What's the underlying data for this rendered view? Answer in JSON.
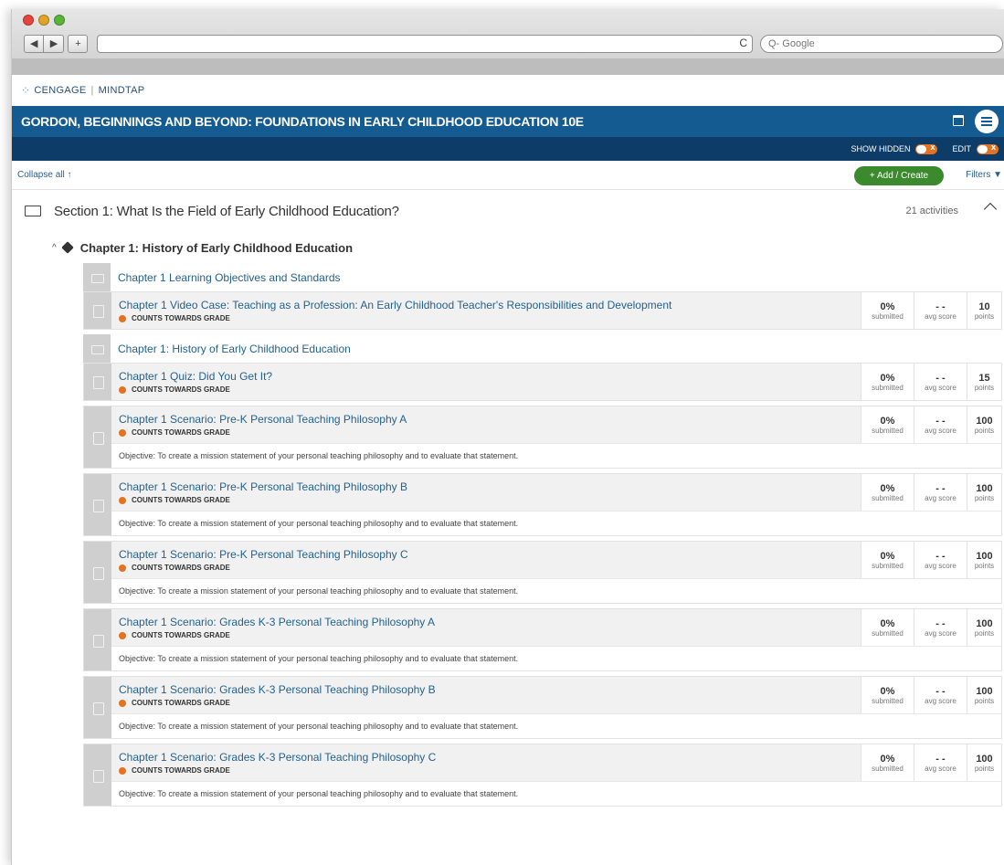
{
  "browser": {
    "back_glyph": "◀",
    "forward_glyph": "▶",
    "new_tab_glyph": "+",
    "reload_glyph": "C",
    "search_placeholder": "Q- Google"
  },
  "brand": {
    "company": "CENGAGE",
    "product": "MINDTAP"
  },
  "course": {
    "title": "GORDON, BEGINNINGS AND BEYOND: FOUNDATIONS IN EARLY CHILDHOOD EDUCATION 10E"
  },
  "toggles": {
    "show_hidden_label": "SHOW HIDDEN",
    "edit_label": "EDIT"
  },
  "toolbar": {
    "collapse_label": "Collapse all ↑",
    "add_label": "+ Add / Create",
    "filters_label": "Filters ▼"
  },
  "section": {
    "title": "Section 1: What Is the Field of Early Childhood Education?",
    "count": "21 activities"
  },
  "chapter": {
    "chev": "^",
    "title": "Chapter 1: History of Early Childhood Education"
  },
  "labels": {
    "counts": "COUNTS TOWARDS GRADE",
    "submitted": "submitted",
    "avg_score": "avg score",
    "points": "points"
  },
  "items": [
    {
      "title": "Chapter 1 Learning Objectives and Standards",
      "type": "doc"
    },
    {
      "title": "Chapter 1 Video Case: Teaching as a Profession: An Early Childhood Teacher's Responsibilities and Development",
      "counts": "COUNTS TOWARDS GRADE",
      "submitted": "0%",
      "avg": "- -",
      "points": "10"
    },
    {
      "title": "Chapter 1: History of Early Childhood Education",
      "type": "doc"
    },
    {
      "title": "Chapter 1 Quiz: Did You Get It?",
      "counts": "COUNTS TOWARDS GRADE",
      "submitted": "0%",
      "avg": "- -",
      "points": "15"
    },
    {
      "title": "Chapter 1 Scenario: Pre-K Personal Teaching Philosophy A",
      "counts": "COUNTS TOWARDS GRADE",
      "submitted": "0%",
      "avg": "- -",
      "points": "100",
      "objective": "Objective: To create a mission statement of your personal teaching philosophy and to evaluate that statement."
    },
    {
      "title": "Chapter 1 Scenario: Pre-K Personal Teaching Philosophy B",
      "counts": "COUNTS TOWARDS GRADE",
      "submitted": "0%",
      "avg": "- -",
      "points": "100",
      "objective": "Objective: To create a mission statement of your personal teaching philosophy and to evaluate that statement."
    },
    {
      "title": "Chapter 1 Scenario: Pre-K Personal Teaching Philosophy C",
      "counts": "COUNTS TOWARDS GRADE",
      "submitted": "0%",
      "avg": "- -",
      "points": "100",
      "objective": "Objective: To create a mission statement of your personal teaching philosophy and to evaluate that statement."
    },
    {
      "title": "Chapter 1 Scenario: Grades K-3 Personal Teaching Philosophy A",
      "counts": "COUNTS TOWARDS GRADE",
      "submitted": "0%",
      "avg": "- -",
      "points": "100",
      "objective": "Objective: To create a mission statement of your personal teaching philosophy and to evaluate that statement."
    },
    {
      "title": "Chapter 1 Scenario: Grades K-3 Personal Teaching Philosophy B",
      "counts": "COUNTS TOWARDS GRADE",
      "submitted": "0%",
      "avg": "- -",
      "points": "100",
      "objective": "Objective: To create a mission statement of your personal teaching philosophy and to evaluate that statement."
    },
    {
      "title": "Chapter 1 Scenario: Grades K-3 Personal Teaching Philosophy C",
      "counts": "COUNTS TOWARDS GRADE",
      "submitted": "0%",
      "avg": "- -",
      "points": "100",
      "objective": "Objective: To create a mission statement of your personal teaching philosophy and to evaluate that statement."
    }
  ],
  "colors": {
    "header_blue": "#135b91",
    "header_dark": "#0c3c67",
    "add_green": "#3c8a2e",
    "accent_orange": "#e4731f",
    "link_blue": "#23628f"
  }
}
